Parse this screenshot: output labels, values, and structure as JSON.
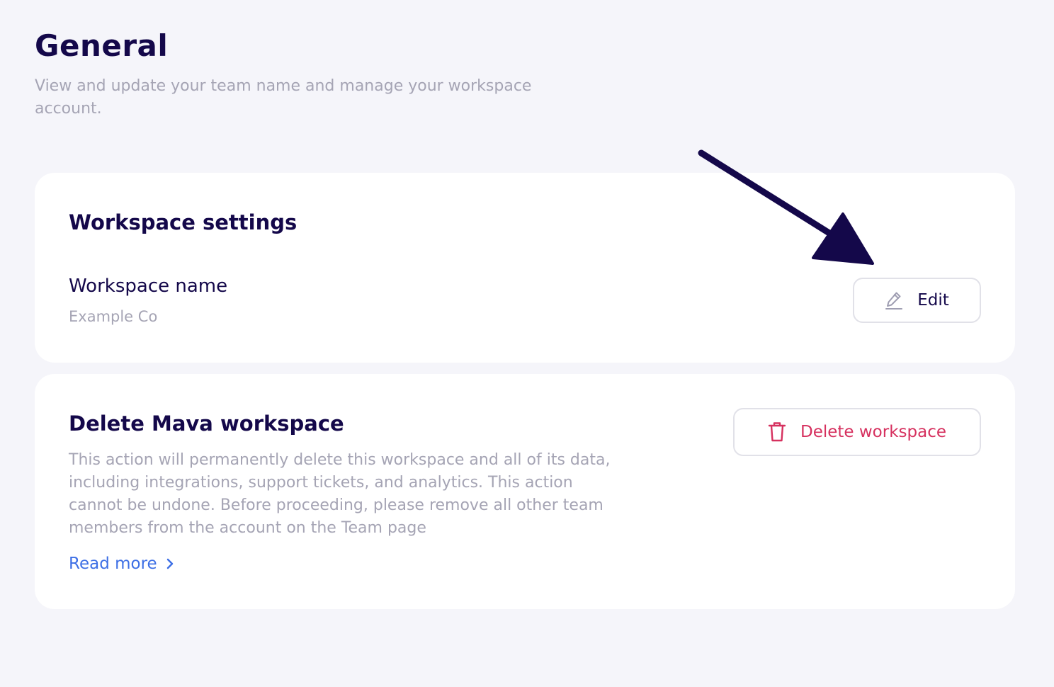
{
  "header": {
    "title": "General",
    "subtitle": "View and update your team name and manage your workspace account."
  },
  "workspace_settings": {
    "title": "Workspace settings",
    "name_label": "Workspace name",
    "name_value": "Example Co",
    "edit_label": "Edit",
    "edit_icon": "pencil-icon"
  },
  "delete_section": {
    "title": "Delete Mava workspace",
    "description": "This action will permanently delete this workspace and all of its data, including integrations, support tickets, and analytics. This action cannot be undone. Before proceeding, please remove all other team members from the account on the Team page",
    "read_more_label": "Read more",
    "read_more_icon": "chevron-right-icon",
    "delete_label": "Delete workspace",
    "delete_icon": "trash-icon"
  },
  "colors": {
    "background": "#f5f5fa",
    "card": "#ffffff",
    "heading": "#14084a",
    "muted_text": "#a5a4b4",
    "danger": "#d6315f",
    "link": "#3d6fe5",
    "annotation_arrow": "#14084a"
  }
}
